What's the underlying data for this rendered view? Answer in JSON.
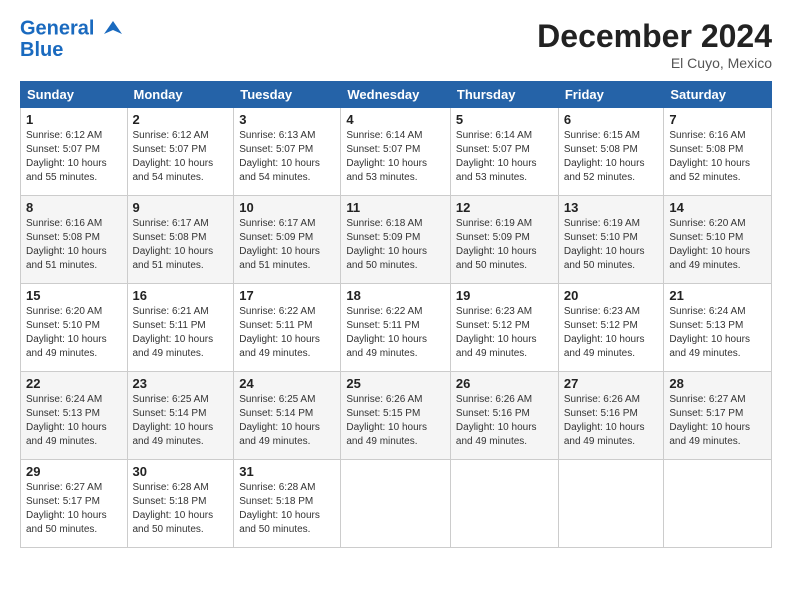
{
  "logo": {
    "line1": "General",
    "line2": "Blue"
  },
  "title": "December 2024",
  "location": "El Cuyo, Mexico",
  "days_of_week": [
    "Sunday",
    "Monday",
    "Tuesday",
    "Wednesday",
    "Thursday",
    "Friday",
    "Saturday"
  ],
  "weeks": [
    [
      {
        "day": "1",
        "info": "Sunrise: 6:12 AM\nSunset: 5:07 PM\nDaylight: 10 hours\nand 55 minutes."
      },
      {
        "day": "2",
        "info": "Sunrise: 6:12 AM\nSunset: 5:07 PM\nDaylight: 10 hours\nand 54 minutes."
      },
      {
        "day": "3",
        "info": "Sunrise: 6:13 AM\nSunset: 5:07 PM\nDaylight: 10 hours\nand 54 minutes."
      },
      {
        "day": "4",
        "info": "Sunrise: 6:14 AM\nSunset: 5:07 PM\nDaylight: 10 hours\nand 53 minutes."
      },
      {
        "day": "5",
        "info": "Sunrise: 6:14 AM\nSunset: 5:07 PM\nDaylight: 10 hours\nand 53 minutes."
      },
      {
        "day": "6",
        "info": "Sunrise: 6:15 AM\nSunset: 5:08 PM\nDaylight: 10 hours\nand 52 minutes."
      },
      {
        "day": "7",
        "info": "Sunrise: 6:16 AM\nSunset: 5:08 PM\nDaylight: 10 hours\nand 52 minutes."
      }
    ],
    [
      {
        "day": "8",
        "info": "Sunrise: 6:16 AM\nSunset: 5:08 PM\nDaylight: 10 hours\nand 51 minutes."
      },
      {
        "day": "9",
        "info": "Sunrise: 6:17 AM\nSunset: 5:08 PM\nDaylight: 10 hours\nand 51 minutes."
      },
      {
        "day": "10",
        "info": "Sunrise: 6:17 AM\nSunset: 5:09 PM\nDaylight: 10 hours\nand 51 minutes."
      },
      {
        "day": "11",
        "info": "Sunrise: 6:18 AM\nSunset: 5:09 PM\nDaylight: 10 hours\nand 50 minutes."
      },
      {
        "day": "12",
        "info": "Sunrise: 6:19 AM\nSunset: 5:09 PM\nDaylight: 10 hours\nand 50 minutes."
      },
      {
        "day": "13",
        "info": "Sunrise: 6:19 AM\nSunset: 5:10 PM\nDaylight: 10 hours\nand 50 minutes."
      },
      {
        "day": "14",
        "info": "Sunrise: 6:20 AM\nSunset: 5:10 PM\nDaylight: 10 hours\nand 49 minutes."
      }
    ],
    [
      {
        "day": "15",
        "info": "Sunrise: 6:20 AM\nSunset: 5:10 PM\nDaylight: 10 hours\nand 49 minutes."
      },
      {
        "day": "16",
        "info": "Sunrise: 6:21 AM\nSunset: 5:11 PM\nDaylight: 10 hours\nand 49 minutes."
      },
      {
        "day": "17",
        "info": "Sunrise: 6:22 AM\nSunset: 5:11 PM\nDaylight: 10 hours\nand 49 minutes."
      },
      {
        "day": "18",
        "info": "Sunrise: 6:22 AM\nSunset: 5:11 PM\nDaylight: 10 hours\nand 49 minutes."
      },
      {
        "day": "19",
        "info": "Sunrise: 6:23 AM\nSunset: 5:12 PM\nDaylight: 10 hours\nand 49 minutes."
      },
      {
        "day": "20",
        "info": "Sunrise: 6:23 AM\nSunset: 5:12 PM\nDaylight: 10 hours\nand 49 minutes."
      },
      {
        "day": "21",
        "info": "Sunrise: 6:24 AM\nSunset: 5:13 PM\nDaylight: 10 hours\nand 49 minutes."
      }
    ],
    [
      {
        "day": "22",
        "info": "Sunrise: 6:24 AM\nSunset: 5:13 PM\nDaylight: 10 hours\nand 49 minutes."
      },
      {
        "day": "23",
        "info": "Sunrise: 6:25 AM\nSunset: 5:14 PM\nDaylight: 10 hours\nand 49 minutes."
      },
      {
        "day": "24",
        "info": "Sunrise: 6:25 AM\nSunset: 5:14 PM\nDaylight: 10 hours\nand 49 minutes."
      },
      {
        "day": "25",
        "info": "Sunrise: 6:26 AM\nSunset: 5:15 PM\nDaylight: 10 hours\nand 49 minutes."
      },
      {
        "day": "26",
        "info": "Sunrise: 6:26 AM\nSunset: 5:16 PM\nDaylight: 10 hours\nand 49 minutes."
      },
      {
        "day": "27",
        "info": "Sunrise: 6:26 AM\nSunset: 5:16 PM\nDaylight: 10 hours\nand 49 minutes."
      },
      {
        "day": "28",
        "info": "Sunrise: 6:27 AM\nSunset: 5:17 PM\nDaylight: 10 hours\nand 49 minutes."
      }
    ],
    [
      {
        "day": "29",
        "info": "Sunrise: 6:27 AM\nSunset: 5:17 PM\nDaylight: 10 hours\nand 50 minutes."
      },
      {
        "day": "30",
        "info": "Sunrise: 6:28 AM\nSunset: 5:18 PM\nDaylight: 10 hours\nand 50 minutes."
      },
      {
        "day": "31",
        "info": "Sunrise: 6:28 AM\nSunset: 5:18 PM\nDaylight: 10 hours\nand 50 minutes."
      },
      {
        "day": "",
        "info": ""
      },
      {
        "day": "",
        "info": ""
      },
      {
        "day": "",
        "info": ""
      },
      {
        "day": "",
        "info": ""
      }
    ]
  ]
}
